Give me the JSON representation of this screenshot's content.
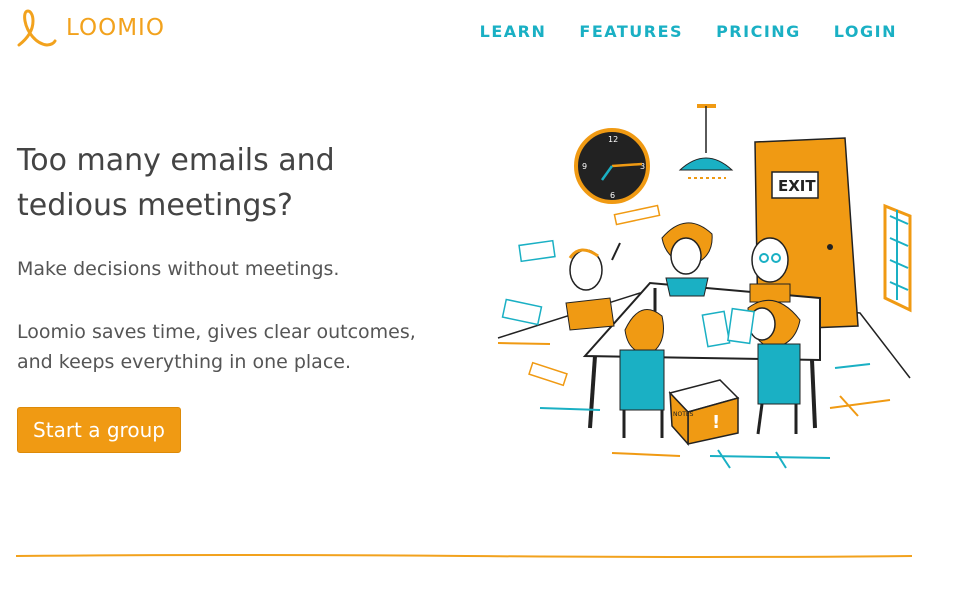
{
  "brand": {
    "name": "LOOMIO",
    "color": "#f2a21d",
    "icon": "loomio-loop-icon"
  },
  "nav": {
    "items": [
      {
        "label": "LEARN"
      },
      {
        "label": "FEATURES"
      },
      {
        "label": "PRICING"
      },
      {
        "label": "LOGIN"
      }
    ],
    "color": "#1ab0c4"
  },
  "hero": {
    "headline": "Too many emails and tedious meetings?",
    "tagline": "Make decisions without meetings.",
    "description": "Loomio saves time, gives clear outcomes, and keeps everything in one place.",
    "cta_label": "Start a group",
    "cta_color": "#f09a13"
  },
  "illustration": {
    "sign_text": "EXIT",
    "box_label": "NOTES",
    "clock_numbers": [
      "12",
      "3",
      "6",
      "9"
    ]
  }
}
